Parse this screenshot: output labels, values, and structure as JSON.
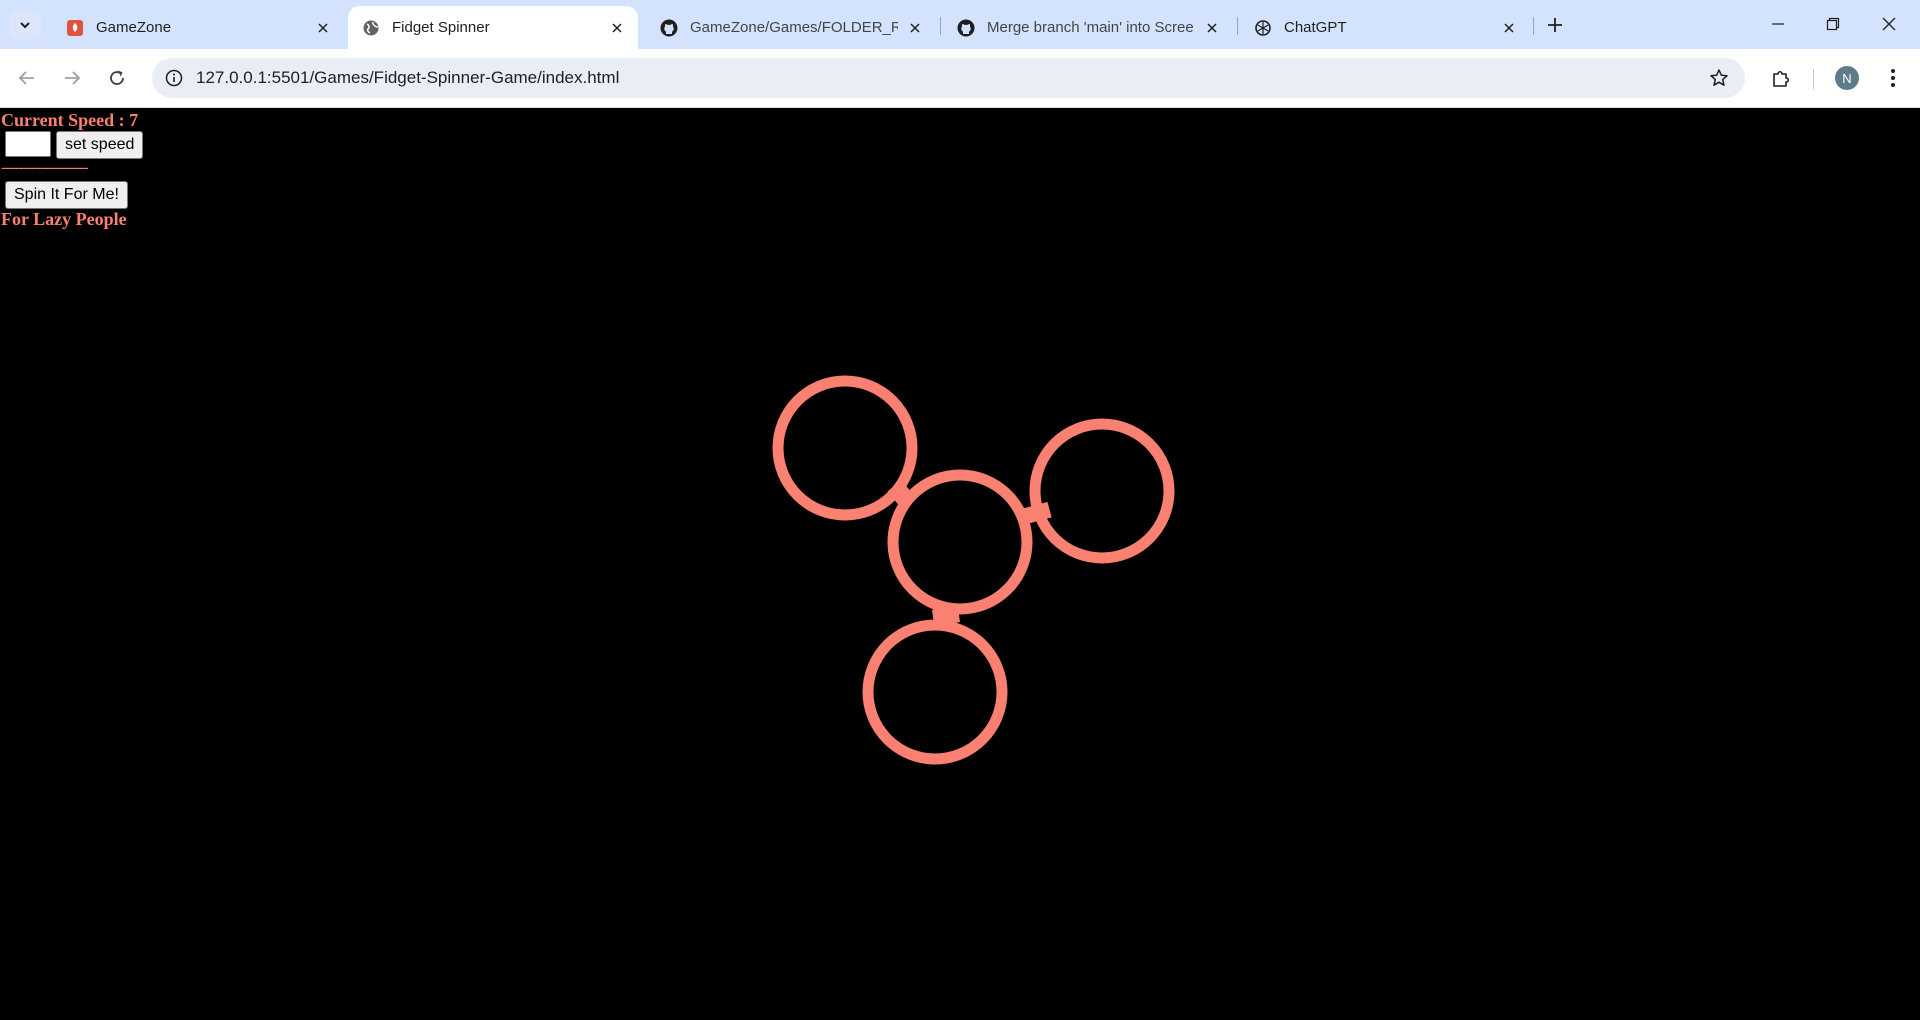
{
  "browser": {
    "tabs": [
      {
        "title": "GameZone",
        "icon": "gamezone-favicon",
        "active": false
      },
      {
        "title": "Fidget Spinner",
        "icon": "globe-icon",
        "active": true
      },
      {
        "title": "GameZone/Games/FOLDER_RE",
        "icon": "github-icon",
        "active": false
      },
      {
        "title": "Merge branch 'main' into Scree",
        "icon": "github-icon",
        "active": false
      },
      {
        "title": "ChatGPT",
        "icon": "chatgpt-icon",
        "active": false
      }
    ],
    "url": "127.0.0.1:5501/Games/Fidget-Spinner-Game/index.html",
    "profile_initial": "N"
  },
  "page": {
    "speed_label": "Current Speed : 7",
    "speed_input_value": "",
    "set_speed_label": "set speed",
    "divider": "--------------------",
    "spin_button_label": "Spin It For Me!",
    "lazy_label": "For Lazy People"
  },
  "colors": {
    "accent": "#fa8072",
    "background": "#000000",
    "tabbar": "#d3e3fd"
  }
}
